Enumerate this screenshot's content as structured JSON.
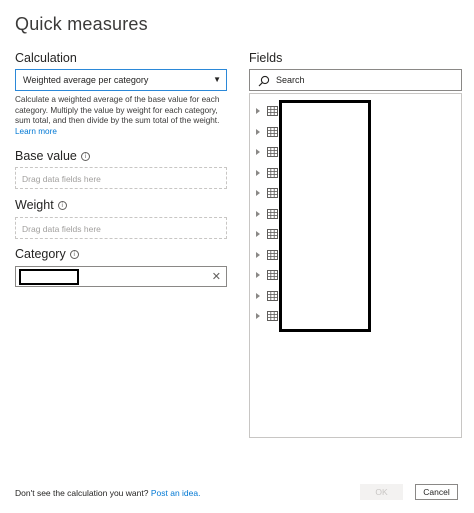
{
  "dialog": {
    "title": "Quick measures"
  },
  "calculation": {
    "label": "Calculation",
    "selected": "Weighted average per category",
    "caret": "▼",
    "description": "Calculate a weighted average of the base value for each category. Multiply the value by weight for each category, sum total, and then divide by the sum total of the weight.",
    "learn_more": "Learn more"
  },
  "base_value": {
    "label": "Base value",
    "placeholder": "Drag data fields here"
  },
  "weight": {
    "label": "Weight",
    "placeholder": "Drag data fields here"
  },
  "category": {
    "label": "Category",
    "remove": "✕"
  },
  "fields": {
    "label": "Fields",
    "search_placeholder": "Search",
    "table_count": 11
  },
  "footer": {
    "prompt": "Don't see the calculation you want?",
    "link": "Post an idea.",
    "ok": "OK",
    "cancel": "Cancel"
  },
  "colors": {
    "accent": "#0078d4",
    "focus_border": "#2b88d8"
  }
}
